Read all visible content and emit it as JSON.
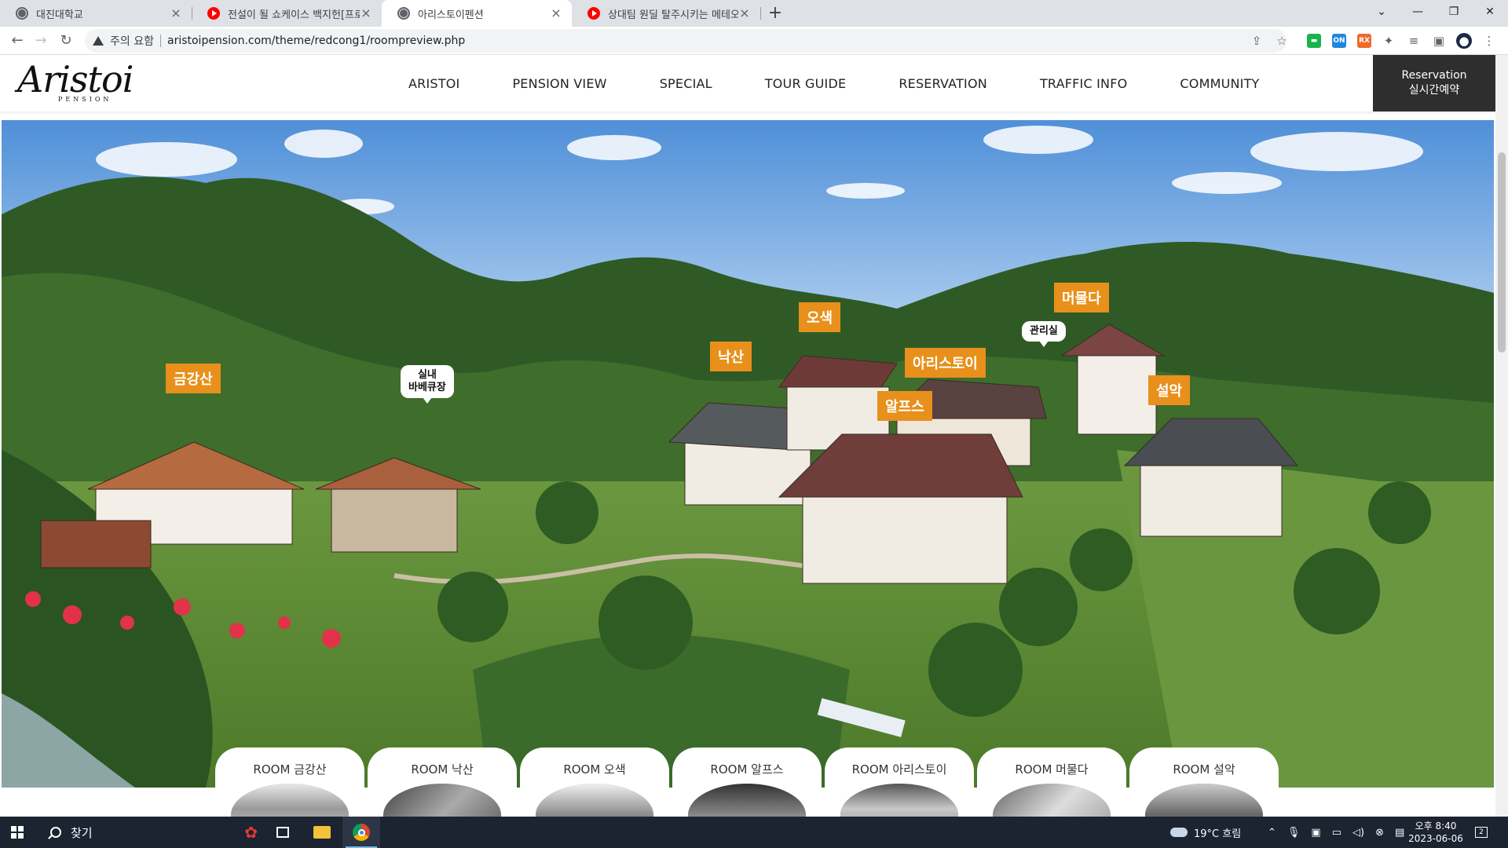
{
  "browser": {
    "tabs": [
      {
        "title": "대진대학교",
        "icon": "globe-icon"
      },
      {
        "title": "전설이 될 쇼케이스 백지헌[프로",
        "icon": "youtube-icon"
      },
      {
        "title": "아리스토이펜션",
        "icon": "globe-icon",
        "active": true
      },
      {
        "title": "상대팀 원딜 탈주시키는 메테오",
        "icon": "youtube-icon"
      }
    ],
    "new_tab_label": "+",
    "security_text": "주의 요함",
    "url": "aristoipension.com/theme/redcong1/roompreview.php"
  },
  "site": {
    "logo_script": "Aristoi",
    "logo_sub": "PENSION",
    "nav": [
      "ARISTOI",
      "PENSION VIEW",
      "SPECIAL",
      "TOUR GUIDE",
      "RESERVATION",
      "TRAFFIC INFO",
      "COMMUNITY"
    ],
    "reservation_line1": "Reservation",
    "reservation_line2": "실시간예약",
    "accent_color": "#e8901b"
  },
  "map_labels": {
    "geumgangsan": "금강산",
    "bbq_line1": "실내",
    "bbq_line2": "바베큐장",
    "naksan": "낙산",
    "osaek": "오색",
    "aristoi": "아리스토이",
    "alps": "알프스",
    "office": "관리실",
    "meomulda": "머물다",
    "seorak": "설악"
  },
  "room_tabs": [
    "ROOM 금강산",
    "ROOM 낙산",
    "ROOM 오색",
    "ROOM 알프스",
    "ROOM 아리스토이",
    "ROOM 머물다",
    "ROOM 설악"
  ],
  "taskbar": {
    "search_placeholder": "찾기",
    "weather": "19°C 흐림",
    "time": "오후 8:40",
    "date": "2023-06-06",
    "notifications": "2"
  }
}
